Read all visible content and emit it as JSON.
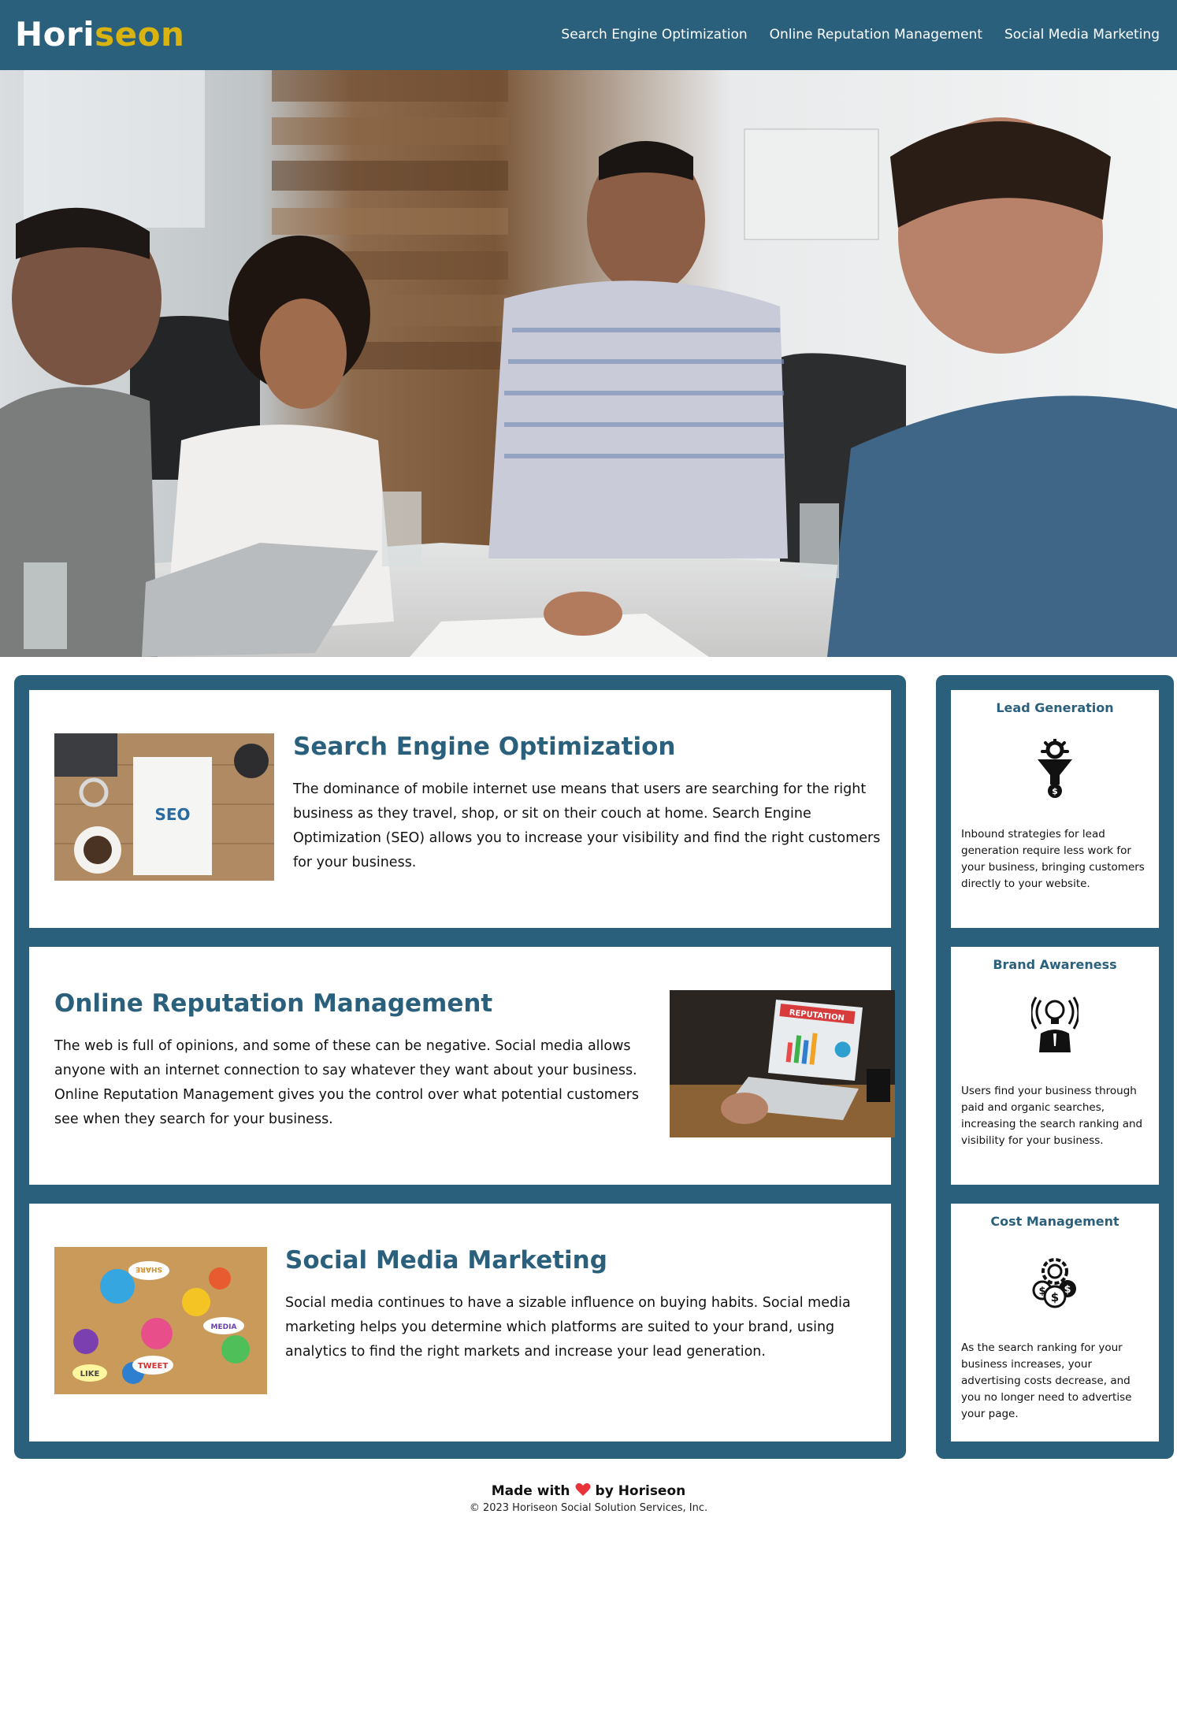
{
  "header": {
    "logo_main": "Hori",
    "logo_accent": "seon",
    "nav": [
      {
        "label": "Search Engine Optimization"
      },
      {
        "label": "Online Reputation Management"
      },
      {
        "label": "Social Media Marketing"
      }
    ]
  },
  "content": {
    "sections": [
      {
        "title": "Search Engine Optimization",
        "text": "The dominance of mobile internet use means that users are searching for the right business as they travel, shop, or sit on their couch at home. Search Engine Optimization (SEO) allows you to increase your visibility and find the right customers for your business.",
        "image_text": "SEO"
      },
      {
        "title": "Online Reputation Management",
        "text": "The web is full of opinions, and some of these can be negative. Social media allows anyone with an internet connection to say whatever they want about your business. Online Reputation Management gives you the control over what potential customers see when they search for your business.",
        "image_text": "REPUTATION"
      },
      {
        "title": "Social Media Marketing",
        "text": "Social media continues to have a sizable influence on buying habits. Social media marketing helps you determine which platforms are suited to your brand, using analytics to find the right markets and increase your lead generation.",
        "image_text_1": "TWEET",
        "image_text_2": "LIKE",
        "image_text_3": "MEDIA",
        "image_text_4": "SHARE"
      }
    ]
  },
  "benefits": [
    {
      "title": "Lead Generation",
      "icon": "lead-generation-funnel-icon",
      "text": "Inbound strategies for lead generation require less work for your business, bringing customers directly to your website."
    },
    {
      "title": "Brand Awareness",
      "icon": "brand-awareness-lightbulb-person-icon",
      "text": "Users find your business through paid and organic searches, increasing the search ranking and visibility for your business."
    },
    {
      "title": "Cost Management",
      "icon": "cost-management-gear-coins-icon",
      "text": "As the search ranking for your business increases, your advertising costs decrease, and you no longer need to advertise your page."
    }
  ],
  "footer": {
    "made_prefix": "Made with",
    "made_suffix": "by Horiseon",
    "copyright": "© 2023 Horiseon Social Solution Services, Inc."
  },
  "colors": {
    "primary": "#2a607c",
    "logo_accent": "#d9b310",
    "heart": "#e8333b"
  }
}
